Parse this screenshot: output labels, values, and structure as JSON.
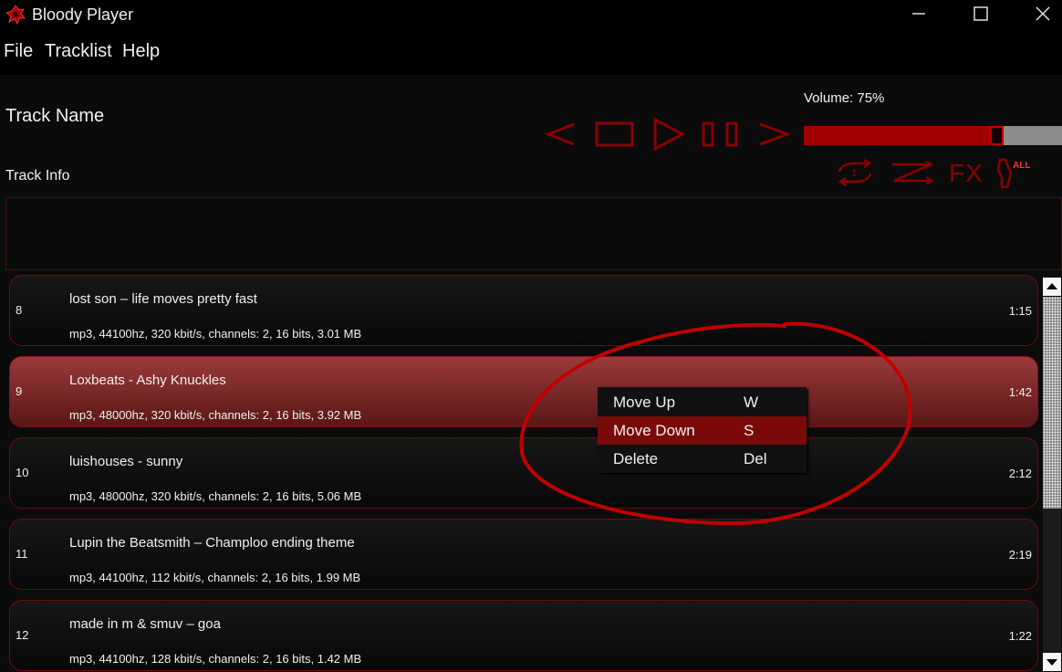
{
  "window": {
    "title": "Bloody Player"
  },
  "menu": [
    "File",
    "Tracklist",
    "Help"
  ],
  "player": {
    "track_name": "Track Name",
    "track_info_label": "Track Info",
    "volume_label": "Volume: 75%",
    "volume_level": 0.75,
    "extra_buttons": {
      "fx_label": "FX",
      "all_label": "ALL"
    }
  },
  "tracks": [
    {
      "num": "8",
      "title": "lost son – life moves pretty fast",
      "meta": "mp3, 44100hz, 320 kbit/s, channels: 2, 16 bits, 3.01 MB",
      "duration": "1:15"
    },
    {
      "num": "9",
      "title": "Loxbeats - Ashy Knuckles",
      "meta": "mp3, 48000hz, 320 kbit/s, channels: 2, 16 bits, 3.92 MB",
      "duration": "1:42"
    },
    {
      "num": "10",
      "title": "luishouses - sunny",
      "meta": "mp3, 48000hz, 320 kbit/s, channels: 2, 16 bits, 5.06 MB",
      "duration": "2:12"
    },
    {
      "num": "11",
      "title": "Lupin the Beatsmith – Champloo ending theme",
      "meta": "mp3, 44100hz, 112 kbit/s, channels: 2, 16 bits, 1.99 MB",
      "duration": "2:19"
    },
    {
      "num": "12",
      "title": "made in m & smuv – goa",
      "meta": "mp3, 44100hz, 128 kbit/s, channels: 2, 16 bits, 1.42 MB",
      "duration": "1:22"
    }
  ],
  "context_menu": [
    {
      "label": "Move Up",
      "key": "W"
    },
    {
      "label": "Move Down",
      "key": "S"
    },
    {
      "label": "Delete",
      "key": "Del"
    }
  ],
  "colors": {
    "accent": "#a00000",
    "background": "#0b0b0b",
    "highlight": "#7a0a0a"
  }
}
